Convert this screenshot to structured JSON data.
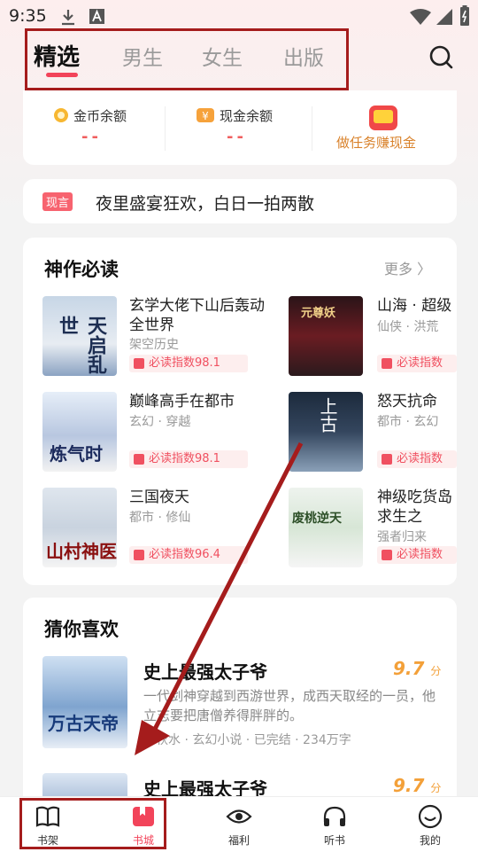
{
  "status_bar": {
    "time": "9:35",
    "icons": [
      "download-icon",
      "a-icon",
      "wifi-icon",
      "signal-icon",
      "battery-icon"
    ]
  },
  "top_tabs": [
    "精选",
    "男生",
    "女生",
    "出版"
  ],
  "active_tab": 0,
  "wallet": {
    "coin_label": "金币余额",
    "coin_value": "--",
    "cash_label": "现金余额",
    "cash_value": "--",
    "task_label": "做任务赚现金"
  },
  "promo": {
    "tag": "现言",
    "title": "夜里盛宴狂欢，白日一拍两散"
  },
  "must_read": {
    "title": "神作必读",
    "more": "更多 〉",
    "books": [
      {
        "title": "玄学大佬下山后轰动全世界",
        "meta": "架空历史",
        "score": "必读指数98.1"
      },
      {
        "title": "巅峰高手在都市",
        "meta": "玄幻 · 穿越",
        "score": "必读指数98.1"
      },
      {
        "title": "三国夜天",
        "meta": "都市 · 修仙",
        "score": "必读指数96.4"
      },
      {
        "title": "山海 · 超级",
        "meta": "仙侠 · 洪荒",
        "score": "必读指数"
      },
      {
        "title": "怒天抗命",
        "meta": "都市 · 玄幻",
        "score": "必读指数"
      },
      {
        "title": "神级吃货岛求生之",
        "meta": "强者归来",
        "score": "必读指数"
      }
    ],
    "cover_texts": [
      "天启乱世",
      "炼气时",
      "山村神医",
      "元尊妖",
      "上古",
      "废桃逆天"
    ]
  },
  "guess": {
    "title": "猜你喜欢",
    "items": [
      {
        "title": "史上最强太子爷",
        "score": "9.7",
        "unit": "分",
        "desc": "一代剑神穿越到西游世界，成西天取经的一员，他立志要把唐僧养得胖胖的。",
        "meta": "刀秋水 · 玄幻小说 · 已完结 · 234万字",
        "cover_text": "万古天帝"
      },
      {
        "title": "史上最强太子爷",
        "score": "9.7",
        "unit": "分"
      }
    ]
  },
  "bottom_nav": [
    {
      "label": "书架",
      "icon": "book-open-icon"
    },
    {
      "label": "书城",
      "icon": "bookmark-icon"
    },
    {
      "label": "福利",
      "icon": "eye-icon"
    },
    {
      "label": "听书",
      "icon": "headphones-icon"
    },
    {
      "label": "我的",
      "icon": "smile-icon"
    }
  ],
  "colors": {
    "accent": "#f2445a",
    "score": "#f3a039",
    "annotation": "#a51c1c"
  }
}
